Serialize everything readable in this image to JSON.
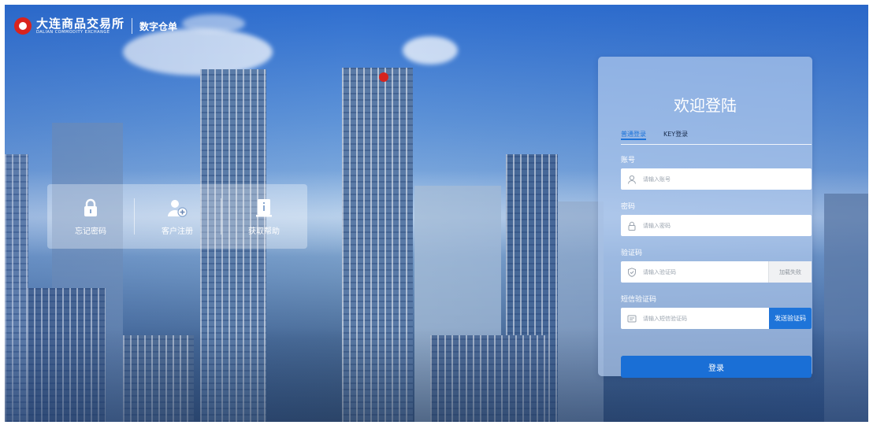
{
  "header": {
    "logo_cn": "大连商品交易所",
    "logo_en": "DALIAN COMMODITY EXCHANGE",
    "product": "数字仓单"
  },
  "quick_links": [
    {
      "label": "忘记密码",
      "icon": "lock-icon"
    },
    {
      "label": "客户注册",
      "icon": "add-user-icon"
    },
    {
      "label": "获取帮助",
      "icon": "help-document-icon"
    }
  ],
  "login": {
    "title": "欢迎登陆",
    "tabs": [
      {
        "label": "普通登录",
        "active": true
      },
      {
        "label": "KEY登录",
        "active": false
      }
    ],
    "account": {
      "label": "账号",
      "placeholder": "请输入账号",
      "value": "",
      "icon": "user-icon"
    },
    "password": {
      "label": "密码",
      "placeholder": "请输入密码",
      "value": "",
      "icon": "lock-icon"
    },
    "captcha": {
      "label": "验证码",
      "placeholder": "请输入验证码",
      "value": "",
      "icon": "shield-icon",
      "image_status": "加载失败"
    },
    "sms": {
      "label": "短信验证码",
      "placeholder": "请输入短信验证码",
      "value": "",
      "icon": "message-icon",
      "send_label": "发送验证码"
    },
    "submit_label": "登录"
  },
  "colors": {
    "brand_red": "#d9231d",
    "accent_blue": "#1e74d9",
    "panel_tint": "#afc8eb"
  }
}
